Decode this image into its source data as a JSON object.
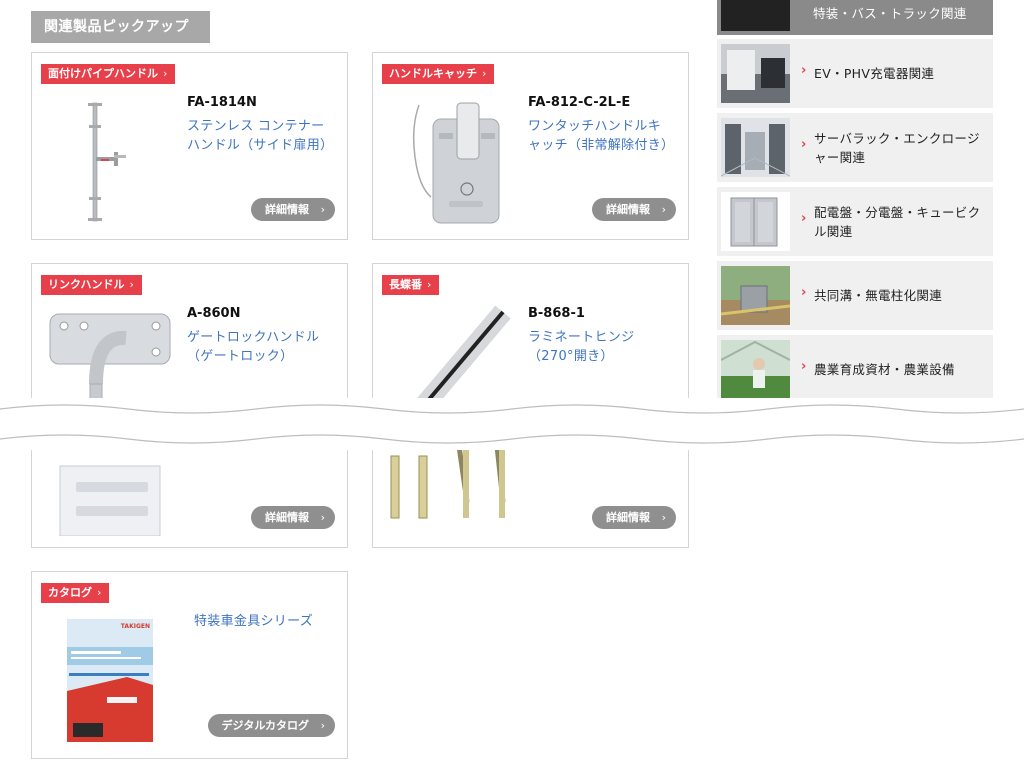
{
  "section": {
    "heading": "関連製品ピックアップ"
  },
  "products": [
    {
      "tag": "面付けパイプハンドル",
      "code": "FA-1814N",
      "name": "ステンレス コンテナーハンドル（サイド扉用）",
      "button": "詳細情報",
      "thumb": "pipe-handle"
    },
    {
      "tag": "ハンドルキャッチ",
      "code": "FA-812-C-2L-E",
      "name": "ワンタッチハンドルキャッチ（非常解除付き）",
      "button": "詳細情報",
      "thumb": "handle-catch"
    },
    {
      "tag": "リンクハンドル",
      "code": "A-860N",
      "name": "ゲートロックハンドル（ゲートロック）",
      "button": "詳細情報",
      "thumb": "link-handle"
    },
    {
      "tag": "長蝶番",
      "code": "B-868-1",
      "name": "ラミネートヒンジ（270°開き）",
      "button": "詳細情報",
      "thumb": "long-hinge"
    }
  ],
  "catalog": {
    "tag": "カタログ",
    "name": "特装車金具シリーズ",
    "button": "デジタルカタログ",
    "cover_brand": "TAKIGEN"
  },
  "sidebar": {
    "top_item": {
      "label": "特装・バス・トラック関連"
    },
    "items": [
      {
        "label": "EV・PHV充電器関連",
        "thumb": "ev-charger"
      },
      {
        "label": "サーバラック・エンクロージャー関連",
        "thumb": "server-rack"
      },
      {
        "label": "配電盤・分電盤・キュービクル関連",
        "thumb": "switchboard"
      },
      {
        "label": "共同溝・無電柱化関連",
        "thumb": "utility-tunnel"
      },
      {
        "label": "農業育成資材・農業設備",
        "thumb": "greenhouse"
      }
    ]
  },
  "icons": {
    "tag_chevron": "›",
    "button_arrow": "›",
    "sidebar_chevron": "›"
  },
  "colors": {
    "accent": "#e8404a",
    "link": "#3e74c2",
    "heading_bg": "#a8a8a8",
    "button_bg": "#8f8f8f",
    "sidebar_bg": "#f0f0f0"
  }
}
